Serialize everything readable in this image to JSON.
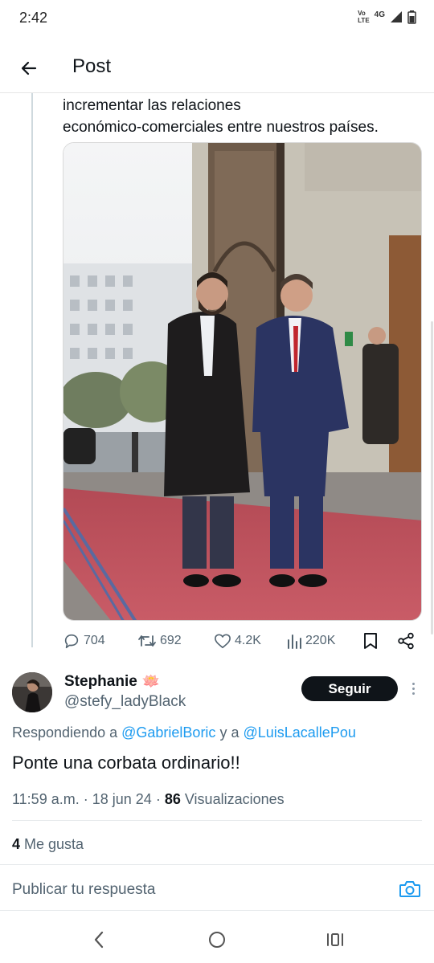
{
  "status_bar": {
    "time": "2:42",
    "volte_top": "Vo",
    "volte_bottom": "LTE",
    "network": "4G",
    "icons": [
      "signal-icon",
      "battery-icon"
    ]
  },
  "header": {
    "title": "Post",
    "back_icon": "arrow-left-icon"
  },
  "tweet": {
    "text_line1": "incrementar las relaciones",
    "text_line2": "económico-comerciales entre nuestros países.",
    "media_alt": "photo",
    "actions": {
      "replies": "704",
      "retweets": "692",
      "likes": "4.2K",
      "views": "220K"
    }
  },
  "reply": {
    "author_name": "Stephanie",
    "author_emoji": "🪷",
    "author_handle": "@stefy_ladyBlack",
    "follow_label": "Seguir",
    "replying_prefix": "Respondiendo a",
    "mention1": "@GabrielBoric",
    "replying_mid": "y a",
    "mention2": "@LuisLacallePou",
    "text": "Ponte una corbata ordinario!!",
    "time": "11:59 a.m.",
    "date": "18 jun 24",
    "views_count": "86",
    "views_label": "Visualizaciones",
    "likes_count": "4",
    "likes_label": "Me gusta"
  },
  "compose": {
    "placeholder": "Publicar tu respuesta"
  },
  "colors": {
    "accent": "#1d9bf0",
    "text_primary": "#0f1419",
    "text_secondary": "#536471",
    "follow_bg": "#0f1419"
  }
}
